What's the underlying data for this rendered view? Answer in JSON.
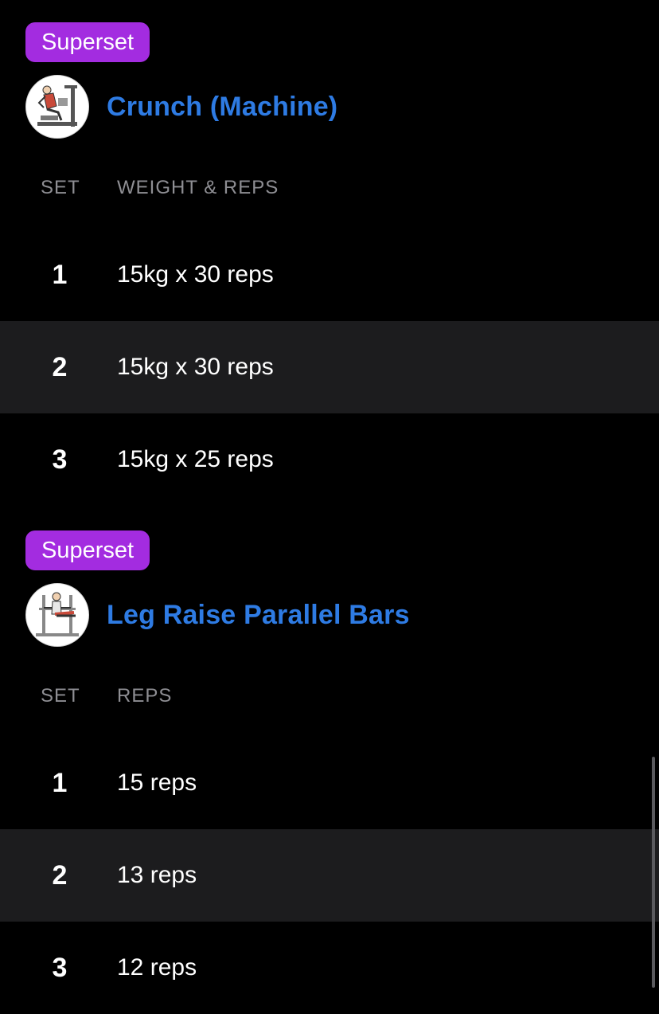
{
  "colors": {
    "badge_bg": "#a32ce0",
    "title": "#2e7be3",
    "alt_row": "#1c1c1e",
    "header_text": "#8e8e93"
  },
  "exercises": [
    {
      "badge": "Superset",
      "title": "Crunch (Machine)",
      "thumbnail_icon": "crunch-machine-illustration",
      "headers": {
        "set": "SET",
        "main": "WEIGHT & REPS"
      },
      "sets": [
        {
          "num": "1",
          "value": "15kg x 30 reps"
        },
        {
          "num": "2",
          "value": "15kg x 30 reps"
        },
        {
          "num": "3",
          "value": "15kg x 25 reps"
        }
      ]
    },
    {
      "badge": "Superset",
      "title": "Leg Raise Parallel Bars",
      "thumbnail_icon": "leg-raise-parallel-bars-illustration",
      "headers": {
        "set": "SET",
        "main": "REPS"
      },
      "sets": [
        {
          "num": "1",
          "value": "15 reps"
        },
        {
          "num": "2",
          "value": "13 reps"
        },
        {
          "num": "3",
          "value": "12 reps"
        }
      ]
    }
  ]
}
